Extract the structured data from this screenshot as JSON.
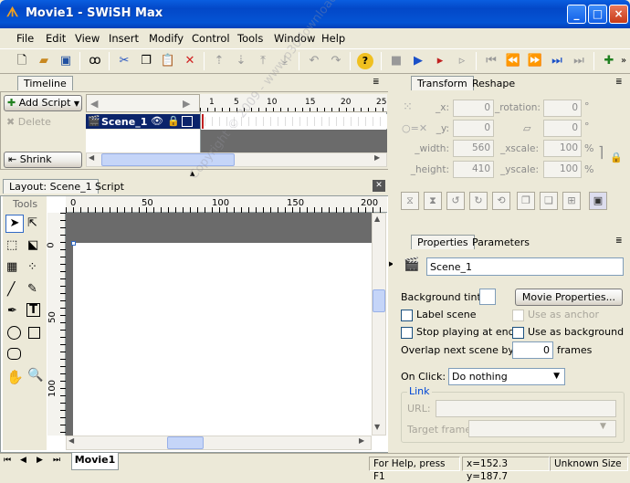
{
  "window": {
    "title": "Movie1 - SWiSH Max",
    "controls": [
      "_",
      "□",
      "×"
    ]
  },
  "menu": [
    "File",
    "Edit",
    "View",
    "Insert",
    "Modify",
    "Control",
    "Tools",
    "Window",
    "Help"
  ],
  "toolbar_icons": [
    "new-icon",
    "open-icon",
    "save-icon",
    "find-icon",
    "cut-icon",
    "copy-icon",
    "paste-icon",
    "delete-icon",
    "bring-forward-icon",
    "send-backward-icon",
    "bring-front-icon",
    "send-back-icon",
    "undo-icon",
    "redo-icon",
    "help-icon",
    "stop-icon",
    "play-icon",
    "play-scene-icon",
    "play-effect-icon",
    "first-frame-icon",
    "prev-frame-icon",
    "next-frame-icon",
    "last-frame-icon",
    "insert-scene-icon",
    "more-icon"
  ],
  "timeline": {
    "tab": "Timeline",
    "add_script": "Add Script",
    "delete": "Delete",
    "shrink": "Shrink",
    "scene_name": "Scene_1",
    "frame_ticks": [
      "1",
      "5",
      "10",
      "15",
      "20",
      "25"
    ]
  },
  "layout": {
    "tab_layout": "Layout: Scene_1",
    "tab_script": "Script",
    "tools_label": "Tools",
    "ruler_top": [
      "0",
      "50",
      "100",
      "150",
      "200"
    ],
    "ruler_left": [
      "0",
      "50",
      "100"
    ],
    "page_tab": "Movie1"
  },
  "watermark": "Copyright © 2009 - www.p30download.com",
  "transform": {
    "tab": "Transform",
    "tab2": "Reshape",
    "fields": [
      {
        "label": "_x:",
        "value": "0"
      },
      {
        "label": "_y:",
        "value": "0"
      },
      {
        "label": "_width:",
        "value": "560"
      },
      {
        "label": "_height:",
        "value": "410"
      }
    ],
    "fields_right": [
      {
        "label": "_rotation:",
        "value": "0",
        "unit": "°"
      },
      {
        "label": "",
        "value": "0",
        "unit": "°"
      },
      {
        "label": "_xscale:",
        "value": "100",
        "unit": "%"
      },
      {
        "label": "_yscale:",
        "value": "100",
        "unit": "%"
      }
    ]
  },
  "properties": {
    "tab": "Properties",
    "tab2": "Parameters",
    "scene_name": "Scene_1",
    "background_tint": "Background tint:",
    "movie_properties": "Movie Properties...",
    "label_scene": "Label scene",
    "use_as_anchor": "Use as anchor",
    "stop_playing": "Stop playing at end",
    "use_as_background": "Use as background",
    "overlap": "Overlap next scene by:",
    "overlap_value": "0",
    "frames": "frames",
    "on_click": "On Click:",
    "on_click_value": "Do nothing",
    "link_group": "Link",
    "url_label": "URL:",
    "target_label": "Target frame:"
  },
  "status": {
    "help": "For Help, press F1",
    "coords": "x=152.3 y=187.7",
    "size": "Unknown Size"
  },
  "colors": {
    "title_bar": "#0348c8",
    "selection": "#0b246a",
    "stage_gray": "#6b6b6b"
  }
}
